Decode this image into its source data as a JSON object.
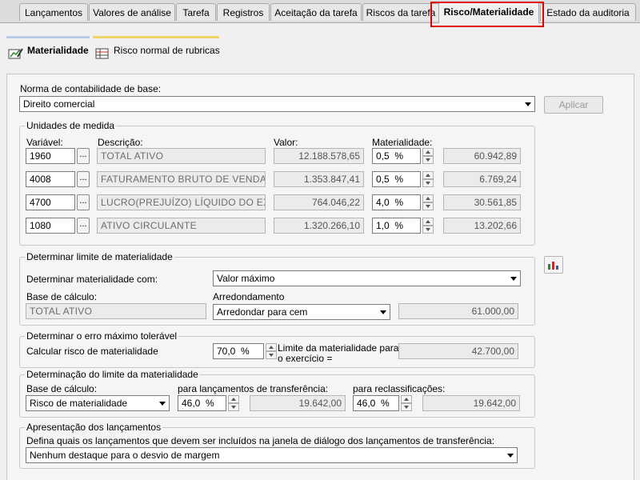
{
  "tabs": [
    {
      "label": "Lançamentos"
    },
    {
      "label": "Valores de análise"
    },
    {
      "label": "Tarefa"
    },
    {
      "label": "Registros"
    },
    {
      "label": "Aceitação da tarefa"
    },
    {
      "label": "Riscos da tarefa"
    },
    {
      "label": "Risco/Materialidade"
    },
    {
      "label": "Estado da auditoria"
    }
  ],
  "subtabs": [
    {
      "label": "Materialidade",
      "bar_color": "#b7cde8"
    },
    {
      "label": "Risco normal de rubricas",
      "bar_color": "#f3d36b"
    }
  ],
  "norma": {
    "label": "Norma de contabilidade de base:",
    "value": "Direito comercial",
    "apply_label": "Aplicar"
  },
  "unidades": {
    "title": "Unidades de medida",
    "col_variavel": "Variável:",
    "col_descricao": "Descrição:",
    "col_valor": "Valor:",
    "col_materialidade": "Materialidade:",
    "dots": "...",
    "rows": [
      {
        "variavel": "1960",
        "descricao": "TOTAL ATIVO",
        "valor": "12.188.578,65",
        "pct": "0,5",
        "unit": "%",
        "result": "60.942,89"
      },
      {
        "variavel": "4008",
        "descricao": "FATURAMENTO BRUTO DE VENDA DE I",
        "valor": "1.353.847,41",
        "pct": "0,5",
        "unit": "%",
        "result": "6.769,24"
      },
      {
        "variavel": "4700",
        "descricao": "LUCRO(PREJUÍZO) LÍQUIDO DO EXERCÍ",
        "valor": "764.046,22",
        "pct": "4,0",
        "unit": "%",
        "result": "30.561,85"
      },
      {
        "variavel": "1080",
        "descricao": "ATIVO CIRCULANTE",
        "valor": "1.320.266,10",
        "pct": "1,0",
        "unit": "%",
        "result": "13.202,66"
      }
    ]
  },
  "limite": {
    "title": "Determinar limite de materialidade",
    "det_label": "Determinar materialidade com:",
    "det_value": "Valor máximo",
    "base_label": "Base de cálculo:",
    "base_value": "TOTAL ATIVO",
    "arred_label": "Arredondamento",
    "arred_value": "Arredondar para cem",
    "result": "61.000,00"
  },
  "erro": {
    "title": "Determinar o erro máximo tolerável",
    "calc_label": "Calcular risco de materialidade",
    "pct": "70,0",
    "unit": "%",
    "limit_label_1": "Limite da materialidade para",
    "limit_label_2": "o exercício =",
    "result": "42.700,00"
  },
  "determinacao": {
    "title": "Determinação do limite da materialidade",
    "base_label": "Base de cálculo:",
    "base_value": "Risco de materialidade",
    "transf_label": "para lançamentos de transferência:",
    "transf_pct": "46,0",
    "transf_unit": "%",
    "transf_result": "19.642,00",
    "reclass_label": "para reclassificações:",
    "reclass_pct": "46,0",
    "reclass_unit": "%",
    "reclass_result": "19.642,00"
  },
  "apresentacao": {
    "title": "Apresentação dos lançamentos",
    "desc": "Defina quais os lançamentos que devem ser incluídos na janela de diálogo dos lançamentos de transferência:",
    "value": "Nenhum destaque para o desvio de margem"
  }
}
